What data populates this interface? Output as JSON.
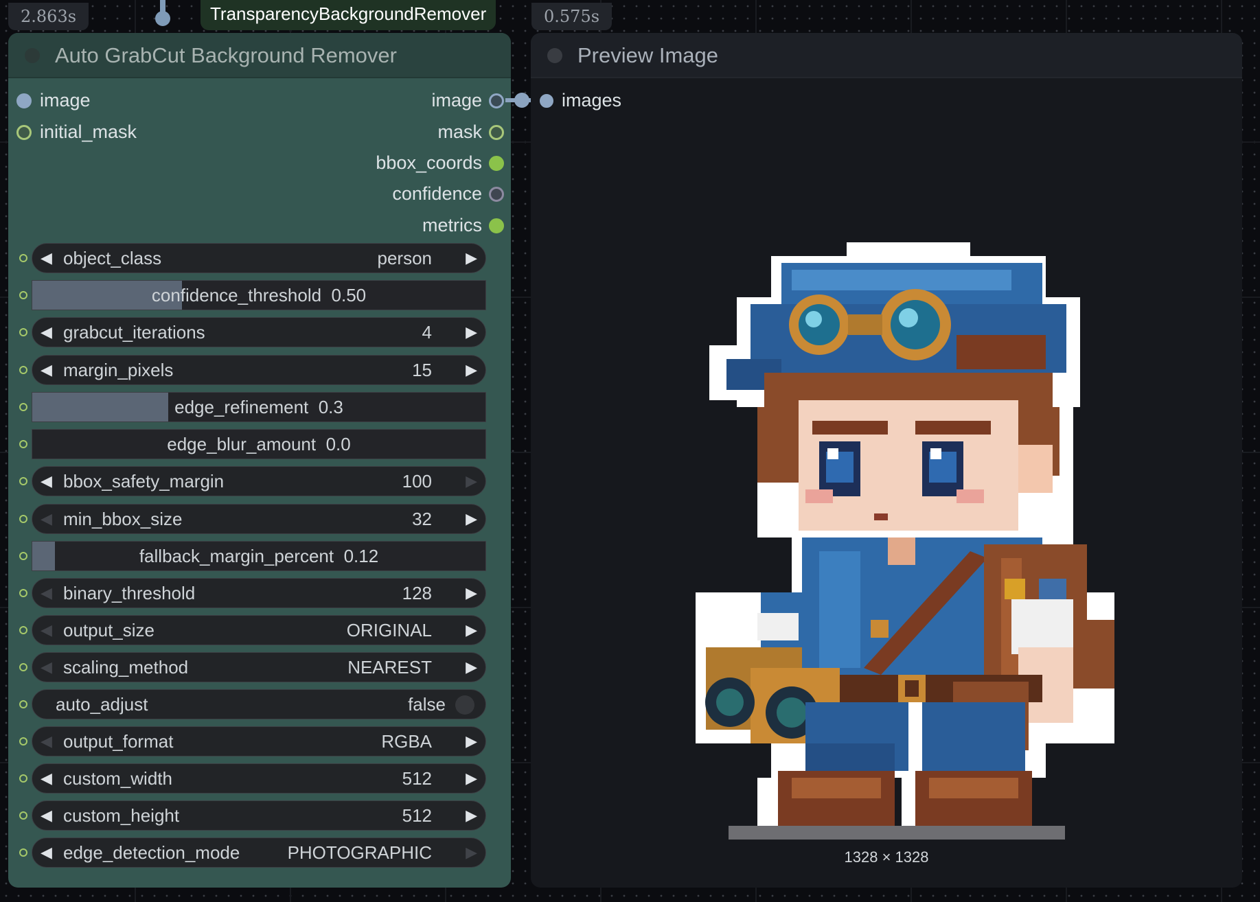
{
  "timings": {
    "left": "2.863s",
    "right": "0.575s"
  },
  "group_title": "TransparencyBackgroundRemover",
  "grabcut_node": {
    "title": "Auto GrabCut Background Remover",
    "inputs": [
      {
        "label": "image",
        "color": "#8fa7c4"
      },
      {
        "label": "initial_mask",
        "color": "#a8c77a"
      }
    ],
    "outputs": [
      {
        "label": "image",
        "color": "#8fa7c4"
      },
      {
        "label": "mask",
        "color": "#a8c77a"
      },
      {
        "label": "bbox_coords",
        "color": "#8bc24a"
      },
      {
        "label": "confidence",
        "color": "#8c8aa0"
      },
      {
        "label": "metrics",
        "color": "#8bc24a"
      }
    ],
    "widgets": {
      "object_class": {
        "name": "object_class",
        "value": "person"
      },
      "confidence_threshold": {
        "name": "confidence_threshold",
        "value": "0.50",
        "fill": 0.33
      },
      "grabcut_iterations": {
        "name": "grabcut_iterations",
        "value": "4"
      },
      "margin_pixels": {
        "name": "margin_pixels",
        "value": "15"
      },
      "edge_refinement": {
        "name": "edge_refinement",
        "value": "0.3",
        "fill": 0.3
      },
      "edge_blur_amount": {
        "name": "edge_blur_amount",
        "value": "0.0",
        "fill": 0.0
      },
      "bbox_safety_margin": {
        "name": "bbox_safety_margin",
        "value": "100"
      },
      "min_bbox_size": {
        "name": "min_bbox_size",
        "value": "32"
      },
      "fallback_margin_percent": {
        "name": "fallback_margin_percent",
        "value": "0.12",
        "fill": 0.05
      },
      "binary_threshold": {
        "name": "binary_threshold",
        "value": "128"
      },
      "output_size": {
        "name": "output_size",
        "value": "ORIGINAL"
      },
      "scaling_method": {
        "name": "scaling_method",
        "value": "NEAREST"
      },
      "auto_adjust": {
        "name": "auto_adjust",
        "value": "false"
      },
      "output_format": {
        "name": "output_format",
        "value": "RGBA"
      },
      "custom_width": {
        "name": "custom_width",
        "value": "512"
      },
      "custom_height": {
        "name": "custom_height",
        "value": "512"
      },
      "edge_detection_mode": {
        "name": "edge_detection_mode",
        "value": "PHOTOGRAPHIC"
      }
    }
  },
  "preview_node": {
    "title": "Preview Image",
    "input_label": "images",
    "image_dimensions": "1328 × 1328"
  },
  "colors": {
    "image_slot": "#8fa7c4",
    "mask_slot": "#a8c77a",
    "node_body": "#355751",
    "node_header": "#2a433f"
  }
}
